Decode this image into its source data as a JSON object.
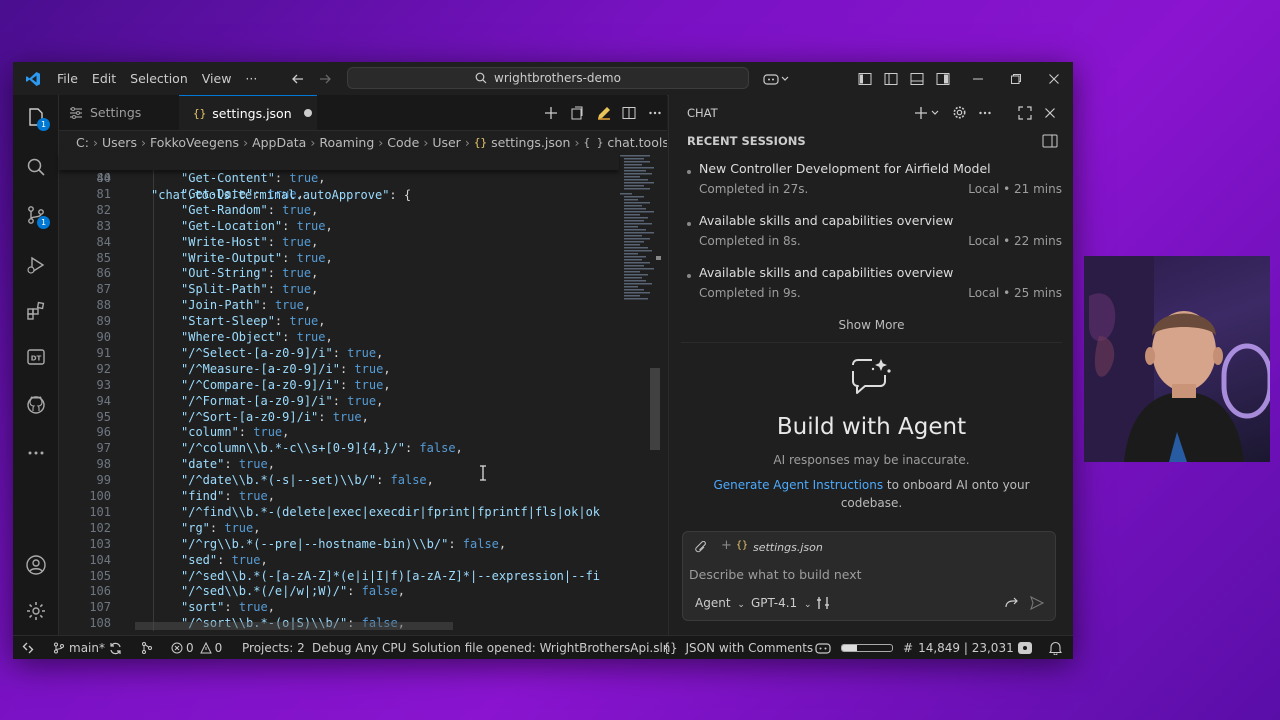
{
  "titlebar": {
    "menu": [
      "File",
      "Edit",
      "Selection",
      "View",
      "···"
    ],
    "search": "wrightbrothers-demo"
  },
  "activity_badges": {
    "explorer": "1",
    "source_control": "1"
  },
  "tabs": [
    {
      "label": "Settings"
    },
    {
      "label": "settings.json"
    }
  ],
  "breadcrumb": [
    "C:",
    "Users",
    "FokkoVeegens",
    "AppData",
    "Roaming",
    "Code",
    "User",
    "settings.json",
    "chat.tools.te"
  ],
  "sticky": {
    "number": "44",
    "key": "\"chat.tools.terminal.autoApprove\"",
    "rest": ": {"
  },
  "code_lines": [
    {
      "n": "80",
      "key": "\"Get-Content\"",
      "val": "true"
    },
    {
      "n": "81",
      "key": "\"Get-Date\"",
      "val": "true"
    },
    {
      "n": "82",
      "key": "\"Get-Random\"",
      "val": "true"
    },
    {
      "n": "83",
      "key": "\"Get-Location\"",
      "val": "true"
    },
    {
      "n": "84",
      "key": "\"Write-Host\"",
      "val": "true"
    },
    {
      "n": "85",
      "key": "\"Write-Output\"",
      "val": "true"
    },
    {
      "n": "86",
      "key": "\"Out-String\"",
      "val": "true"
    },
    {
      "n": "87",
      "key": "\"Split-Path\"",
      "val": "true"
    },
    {
      "n": "88",
      "key": "\"Join-Path\"",
      "val": "true"
    },
    {
      "n": "89",
      "key": "\"Start-Sleep\"",
      "val": "true"
    },
    {
      "n": "90",
      "key": "\"Where-Object\"",
      "val": "true"
    },
    {
      "n": "91",
      "key": "\"/^Select-[a-z0-9]/i\"",
      "val": "true"
    },
    {
      "n": "92",
      "key": "\"/^Measure-[a-z0-9]/i\"",
      "val": "true"
    },
    {
      "n": "93",
      "key": "\"/^Compare-[a-z0-9]/i\"",
      "val": "true"
    },
    {
      "n": "94",
      "key": "\"/^Format-[a-z0-9]/i\"",
      "val": "true"
    },
    {
      "n": "95",
      "key": "\"/^Sort-[a-z0-9]/i\"",
      "val": "true"
    },
    {
      "n": "96",
      "key": "\"column\"",
      "val": "true"
    },
    {
      "n": "97",
      "key": "\"/^column\\\\b.*-c\\\\s+[0-9]{4,}/\"",
      "val": "false"
    },
    {
      "n": "98",
      "key": "\"date\"",
      "val": "true"
    },
    {
      "n": "99",
      "key": "\"/^date\\\\b.*(-s|--set)\\\\b/\"",
      "val": "false"
    },
    {
      "n": "100",
      "key": "\"find\"",
      "val": "true"
    },
    {
      "n": "101",
      "key": "\"/^find\\\\b.*-(delete|exec|execdir|fprint|fprintf|fls|ok|ok",
      "val": ""
    },
    {
      "n": "102",
      "key": "\"rg\"",
      "val": "true"
    },
    {
      "n": "103",
      "key": "\"/^rg\\\\b.*(--pre|--hostname-bin)\\\\b/\"",
      "val": "false"
    },
    {
      "n": "104",
      "key": "\"sed\"",
      "val": "true"
    },
    {
      "n": "105",
      "key": "\"/^sed\\\\b.*(-[a-zA-Z]*(e|i|I|f)[a-zA-Z]*|--expression|--fi",
      "val": ""
    },
    {
      "n": "106",
      "key": "\"/^sed\\\\b.*(/e|/w|;W)/\"",
      "val": "false"
    },
    {
      "n": "107",
      "key": "\"sort\"",
      "val": "true"
    },
    {
      "n": "108",
      "key": "\"/^sort\\\\b.*-(o|S)\\\\b/\"",
      "val": "false"
    }
  ],
  "chat": {
    "header": "CHAT",
    "recent_sessions": "RECENT SESSIONS",
    "sessions": [
      {
        "title": "New Controller Development for Airfield Model",
        "status": "Completed in 27s.",
        "meta": "Local • 21 mins"
      },
      {
        "title": "Available skills and capabilities overview",
        "status": "Completed in 8s.",
        "meta": "Local • 22 mins"
      },
      {
        "title": "Available skills and capabilities overview",
        "status": "Completed in 9s.",
        "meta": "Local • 25 mins"
      }
    ],
    "show_more": "Show More",
    "build_title": "Build with Agent",
    "disclaimer": "AI responses may be inaccurate.",
    "generate_link": "Generate Agent Instructions",
    "generate_rest": " to onboard AI onto your",
    "generate_rest2": "codebase.",
    "context_file": "settings.json",
    "placeholder": "Describe what to build next",
    "mode": "Agent",
    "model": "GPT-4.1"
  },
  "status": {
    "branch": "main*",
    "errors": "0",
    "warnings": "0",
    "projects": "Projects: 2",
    "debug": "Debug Any CPU",
    "solution": "Solution file opened: WrightBrothersApi.sln",
    "language": "JSON with Comments",
    "position": "14,849 | 23,031"
  },
  "colors": {
    "accent": "#0078d4",
    "key": "#9cdcfe",
    "string": "#ce9178",
    "bool": "#569cd6",
    "link": "#4daafc"
  }
}
